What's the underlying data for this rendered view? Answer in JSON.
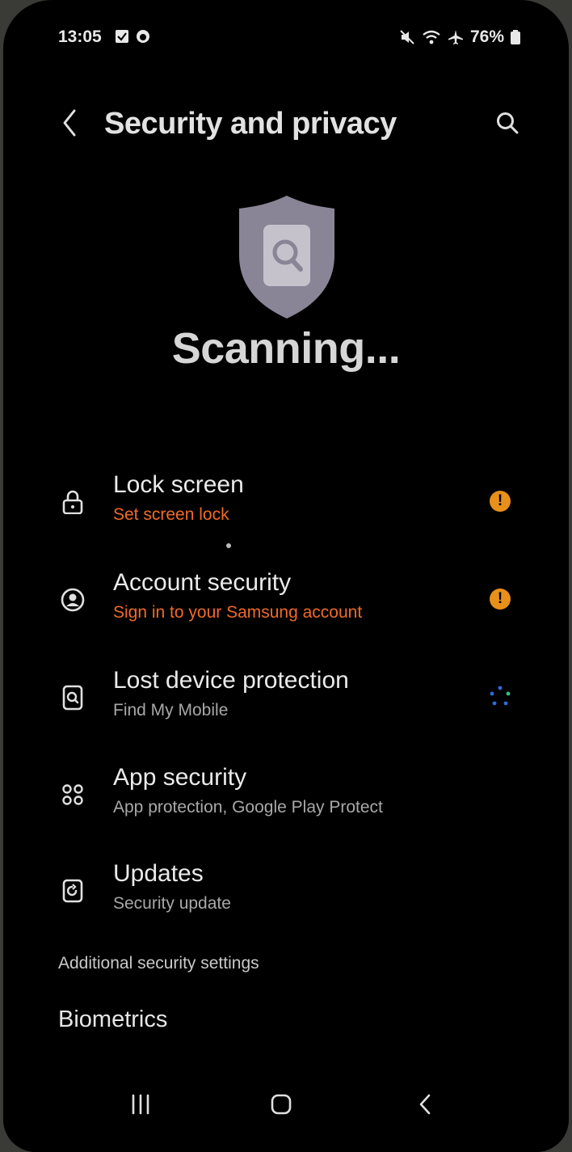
{
  "status_bar": {
    "time": "13:05",
    "battery": "76%",
    "icons": [
      "checkbox-notification-icon",
      "circle-notification-icon",
      "mute-icon",
      "wifi-icon",
      "airplane-icon",
      "battery-icon"
    ]
  },
  "header": {
    "title": "Security and privacy",
    "back_icon": "chevron-left-icon",
    "search_icon": "search-icon"
  },
  "hero": {
    "icon": "shield-scan-icon",
    "status_text": "Scanning..."
  },
  "items": [
    {
      "title": "Lock screen",
      "subtitle": "Set screen lock",
      "subtitle_warning": true,
      "icon": "lock-icon",
      "status": "warning-icon"
    },
    {
      "title": "Account security",
      "subtitle": "Sign in to your Samsung account",
      "subtitle_warning": true,
      "icon": "account-circle-icon",
      "status": "warning-icon"
    },
    {
      "title": "Lost device protection",
      "subtitle": "Find My Mobile",
      "subtitle_warning": false,
      "icon": "find-device-icon",
      "status": "loading-spinner-icon"
    },
    {
      "title": "App security",
      "subtitle": "App protection, Google Play Protect",
      "subtitle_warning": false,
      "icon": "apps-grid-icon",
      "status": ""
    },
    {
      "title": "Updates",
      "subtitle": "Security update",
      "subtitle_warning": false,
      "icon": "update-icon",
      "status": ""
    }
  ],
  "additional_link": "Additional security settings",
  "biometrics": "Biometrics",
  "nav": {
    "recents_icon": "recents-icon",
    "home_icon": "home-icon",
    "back_icon": "nav-back-icon"
  },
  "colors": {
    "background": "#000000",
    "warning_text": "#f06a28",
    "warning_badge": "#e8901a",
    "shield": "#8a8596"
  }
}
